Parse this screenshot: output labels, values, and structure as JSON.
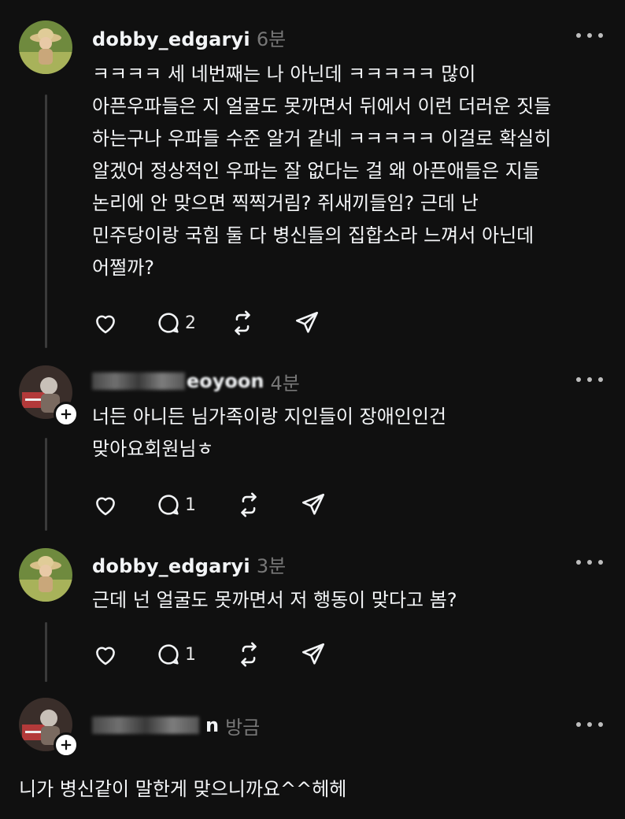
{
  "comments": [
    {
      "username": "dobby_edgaryi",
      "time": "6분",
      "text": "ㅋㅋㅋㅋ 세 네번째는 나 아닌데 ㅋㅋㅋㅋㅋ 많이\n아픈우파들은 지 얼굴도 못까면서 뒤에서 이런 더러운 짓들\n하는구나 우파들 수준 알거 같네 ㅋㅋㅋㅋㅋ 이걸로 확실히\n알겠어 정상적인 우파는 잘 없다는 걸 왜 아픈애들은 지들\n논리에 안 맞으면 찍찍거림? 쥐새끼들임? 근데 난\n민주당이랑 국힘 둘 다 병신들의 집합소라 느껴서 아닌데\n어쩔까?",
      "reply_count": "2"
    },
    {
      "username_visible": "eoyoon",
      "time": "4분",
      "text": "너든 아니든 님가족이랑 지인들이 장애인인건\n맞아요회원님ㅎ",
      "reply_count": "1"
    },
    {
      "username": "dobby_edgaryi",
      "time": "3분",
      "text": "근데 넌 얼굴도 못까면서 저 행동이 맞다고 봄?",
      "reply_count": "1"
    },
    {
      "username_visible": "n",
      "time": "방금",
      "text": "니가 병신같이 말한게 맞으니까요^^헤헤"
    }
  ],
  "icons": {
    "like": "heart-icon",
    "reply": "comment-icon",
    "repost": "repost-icon",
    "share": "send-icon",
    "more": "more-icon",
    "follow": "plus-icon"
  },
  "colors": {
    "background": "#101010",
    "text": "#f3f5f7",
    "muted": "#777777",
    "thread": "#3a3a3a"
  }
}
